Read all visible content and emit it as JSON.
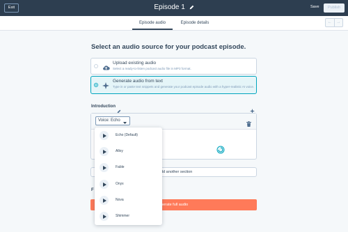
{
  "topbar": {
    "exit_label": "Exit",
    "title": "Episode 1",
    "save_label": "Save",
    "publish_label": "Publish"
  },
  "tabs": [
    {
      "label": "Episode audio",
      "active": true
    },
    {
      "label": "Episode details",
      "active": false
    }
  ],
  "heading": "Select an audio source for your podcast episode.",
  "options": [
    {
      "title": "Upload existing audio",
      "description": "Select a ready-to-listen podcast audio file in MP3 format.",
      "icon": "cloud-upload-icon",
      "selected": false
    },
    {
      "title": "Generate audio from text",
      "description": "Type in or paste text snippets and generate your podcast episode audio with a hyper-realistic AI voice.",
      "icon": "sparkle-icon",
      "selected": true
    }
  ],
  "section": {
    "label": "Introduction",
    "voice_select": "Voice: Echo"
  },
  "voice_menu": [
    {
      "name": "Echo (Default)"
    },
    {
      "name": "Alloy"
    },
    {
      "name": "Fable"
    },
    {
      "name": "Onyx"
    },
    {
      "name": "Nova"
    },
    {
      "name": "Shimmer"
    }
  ],
  "add_section_label": "dd another section",
  "partial_label": "F",
  "generate_label": "enerate full audio",
  "colors": {
    "topbar": "#2d3e50",
    "accent": "#00a4bd",
    "cta": "#ff7a59"
  }
}
